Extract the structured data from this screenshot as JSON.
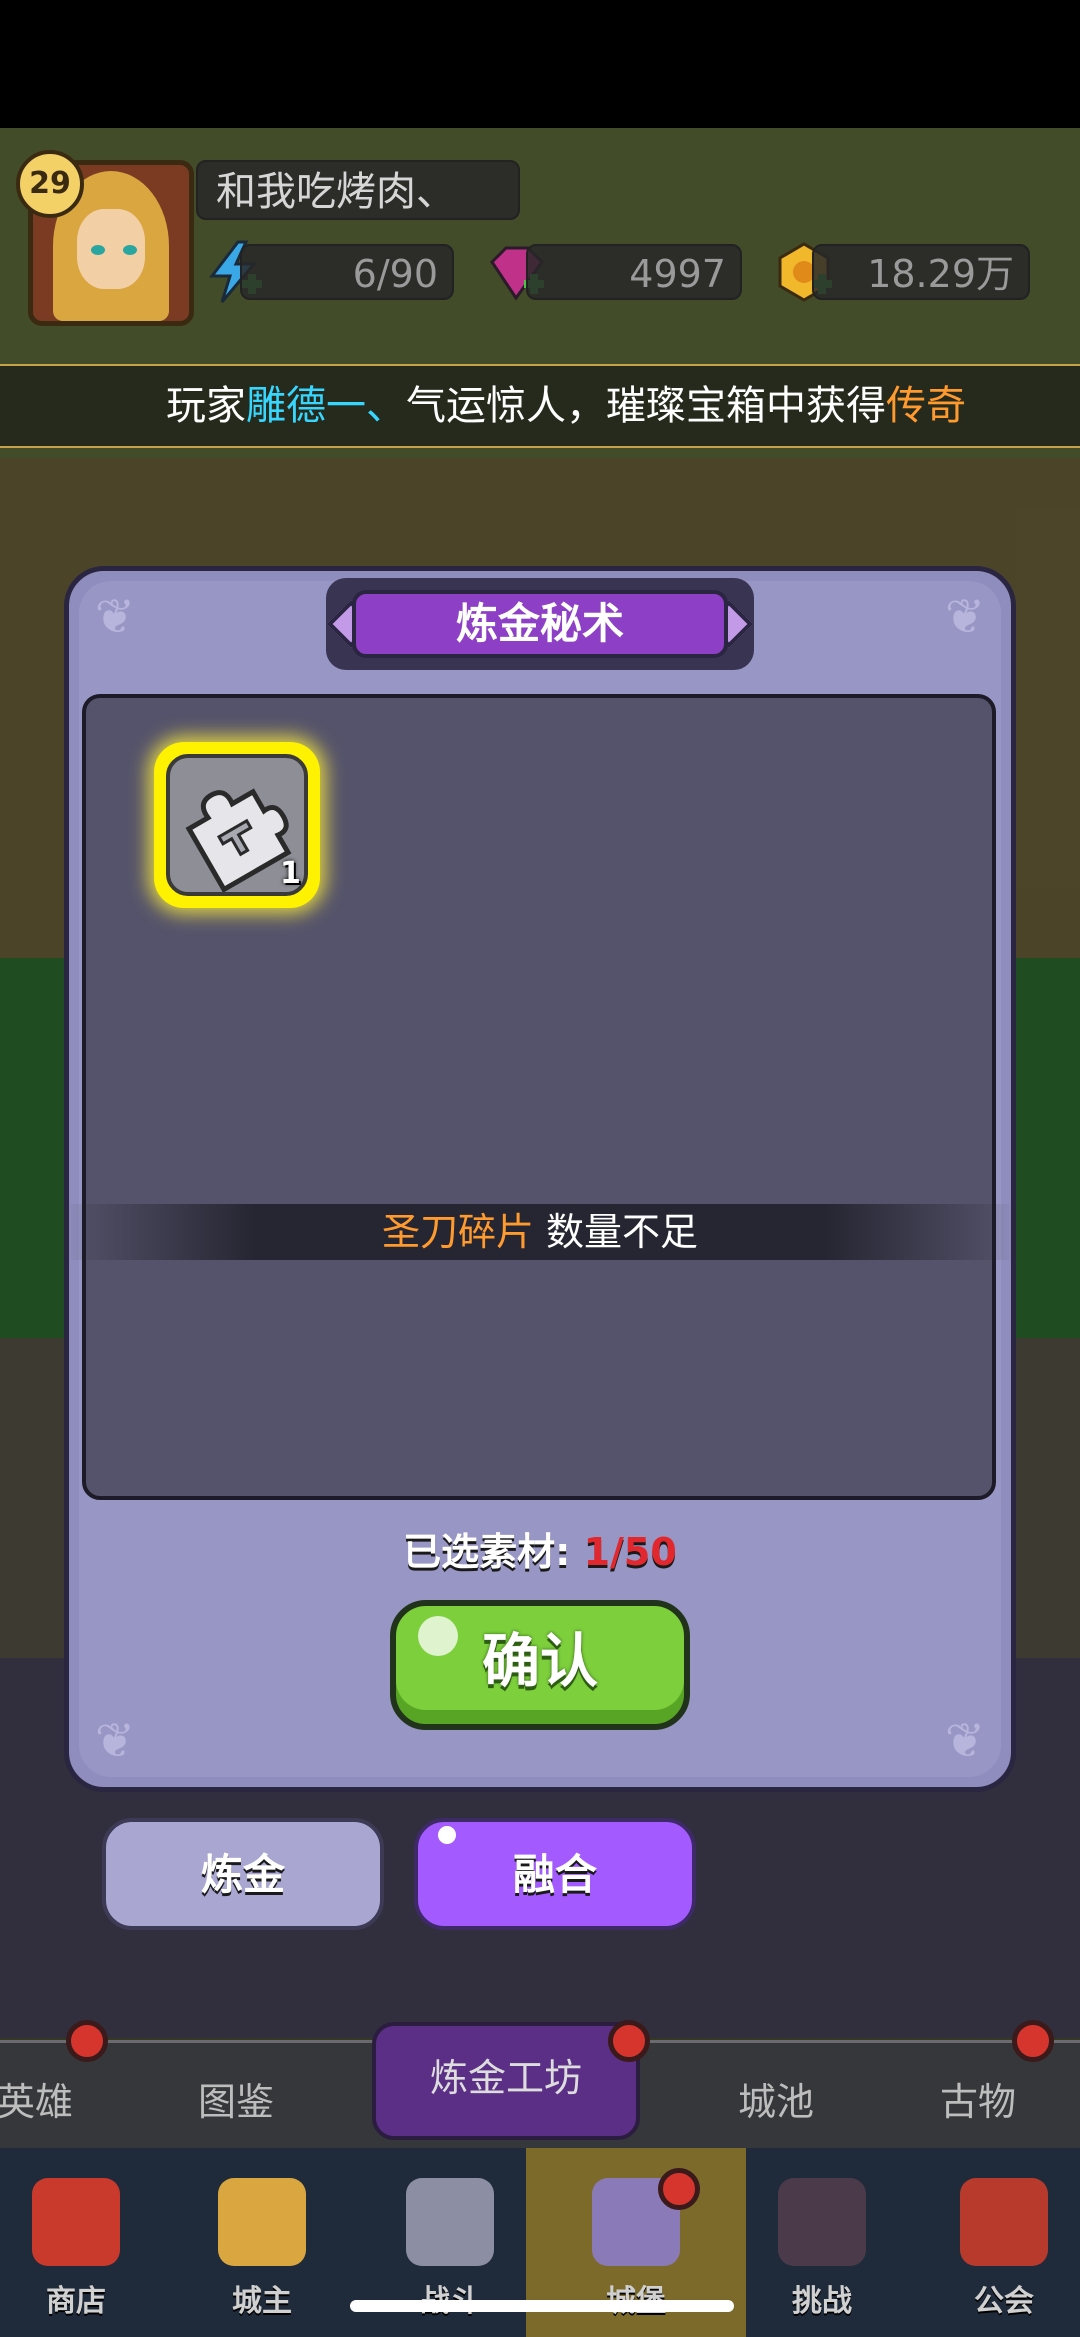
{
  "header": {
    "level": "29",
    "player_name": "和我吃烤肉、",
    "stamina": "6/90",
    "gems": "4997",
    "gold": "18.29万"
  },
  "banner": {
    "prefix": "玩家",
    "player": "雕德一、",
    "middle": "气运惊人，璀璨宝箱中获得",
    "reward": "传奇"
  },
  "modal": {
    "title": "炼金秘术",
    "item": {
      "icon": "puzzle-piece-icon",
      "count": "1"
    },
    "notice_item": "圣刀碎片",
    "notice_text": "数量不足",
    "selected_label": "已选素材:",
    "selected_count": "1/50",
    "confirm_label": "确认"
  },
  "tabs": [
    {
      "label": "炼金",
      "active": false
    },
    {
      "label": "融合",
      "active": true
    }
  ],
  "subnav": [
    {
      "label": "英雄",
      "badge": true
    },
    {
      "label": "图鉴",
      "badge": false
    },
    {
      "label": "炼金工坊",
      "badge": true,
      "active": true
    },
    {
      "label": "城池",
      "badge": false
    },
    {
      "label": "古物",
      "badge": true
    }
  ],
  "mainnav": [
    {
      "label": "商店",
      "icon": "shop-icon"
    },
    {
      "label": "城主",
      "icon": "crown-icon"
    },
    {
      "label": "战斗",
      "icon": "crossed-swords-icon"
    },
    {
      "label": "城堡",
      "icon": "castle-icon",
      "active": true
    },
    {
      "label": "挑战",
      "icon": "demon-icon"
    },
    {
      "label": "公会",
      "icon": "guild-banner-icon"
    }
  ],
  "colors": {
    "highlight_cyan": "#36d6ff",
    "highlight_orange": "#ff9a2e",
    "count_red": "#e0282e",
    "confirm_green": "#7dcf3c",
    "fusion_purple": "#a35bff"
  }
}
